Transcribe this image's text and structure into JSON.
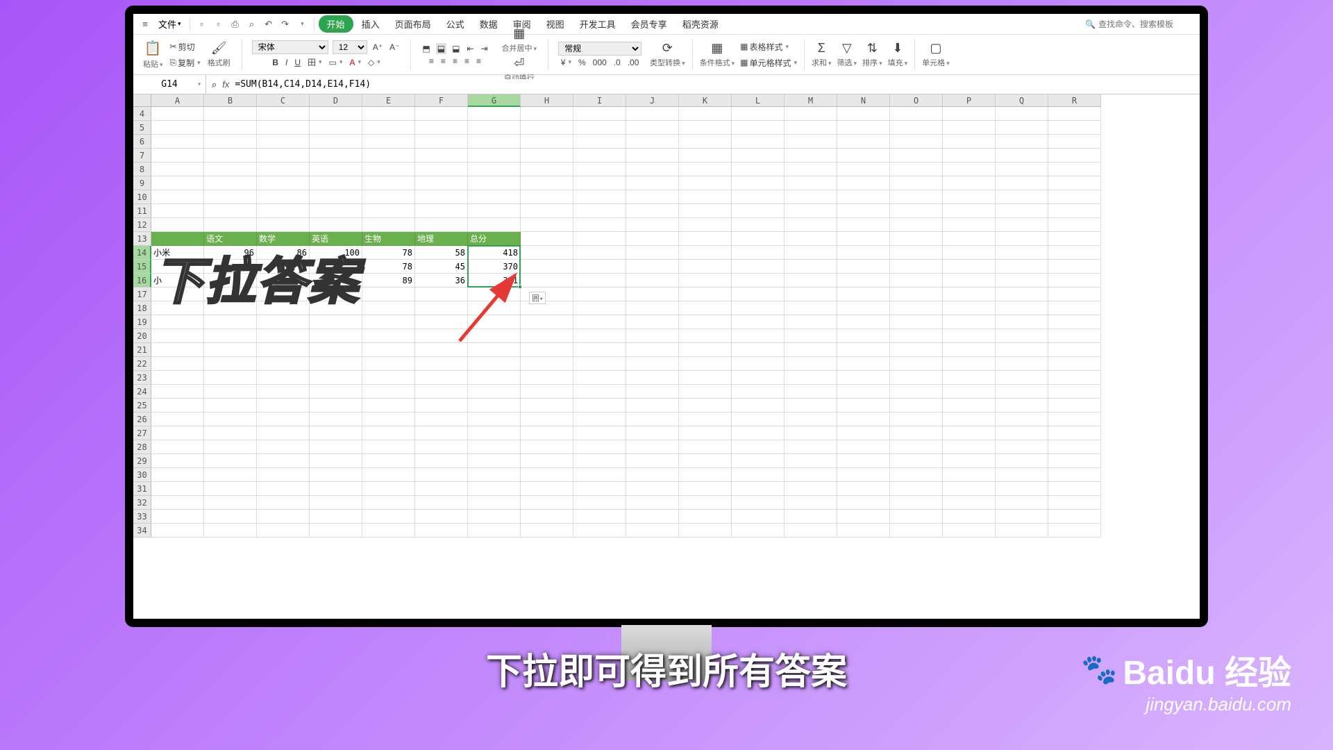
{
  "menubar": {
    "file_label": "文件",
    "tabs": [
      "开始",
      "插入",
      "页面布局",
      "公式",
      "数据",
      "审阅",
      "视图",
      "开发工具",
      "会员专享",
      "稻壳资源"
    ],
    "search_placeholder": "查找命令、搜索模板"
  },
  "ribbon": {
    "paste": "粘贴",
    "cut": "剪切",
    "copy": "复制",
    "format_painter": "格式刷",
    "font_name": "宋体",
    "font_size": "12",
    "merge_center": "合并居中",
    "auto_wrap": "自动换行",
    "number_format": "常规",
    "type_convert": "类型转换",
    "cond_format": "条件格式",
    "table_style": "表格样式",
    "cell_style": "单元格样式",
    "sum": "求和",
    "filter": "筛选",
    "sort": "排序",
    "fill": "填充",
    "cell": "单元格"
  },
  "formula_bar": {
    "name_box": "G14",
    "formula": "=SUM(B14,C14,D14,E14,F14)"
  },
  "sheet": {
    "columns": [
      "A",
      "B",
      "C",
      "D",
      "E",
      "F",
      "G",
      "H",
      "I",
      "J",
      "K",
      "L",
      "M",
      "N",
      "O",
      "P",
      "Q",
      "R"
    ],
    "first_row": 4,
    "last_row": 34,
    "selected_col": "G",
    "selected_rows": [
      14,
      15,
      16
    ],
    "header_row": 13,
    "headers": [
      "",
      "语文",
      "数学",
      "英语",
      "生物",
      "地理",
      "总分"
    ],
    "data_rows": [
      {
        "row": 14,
        "A": "小米",
        "B": 96,
        "C": 86,
        "D": 100,
        "E": 78,
        "F": 58,
        "G": 418
      },
      {
        "row": 15,
        "A": "",
        "B": "",
        "C": "",
        "D": "",
        "E": 78,
        "F": 45,
        "G": 370
      },
      {
        "row": 16,
        "A": "小",
        "B": "",
        "C": "",
        "D": "",
        "E": 89,
        "F": 36,
        "G": 391
      }
    ],
    "autofill_icon": "囲"
  },
  "overlay": {
    "big_text": "下拉答案",
    "caption": "下拉即可得到所有答案"
  },
  "watermark": {
    "brand": "Baidu 经验",
    "url": "jingyan.baidu.com"
  }
}
